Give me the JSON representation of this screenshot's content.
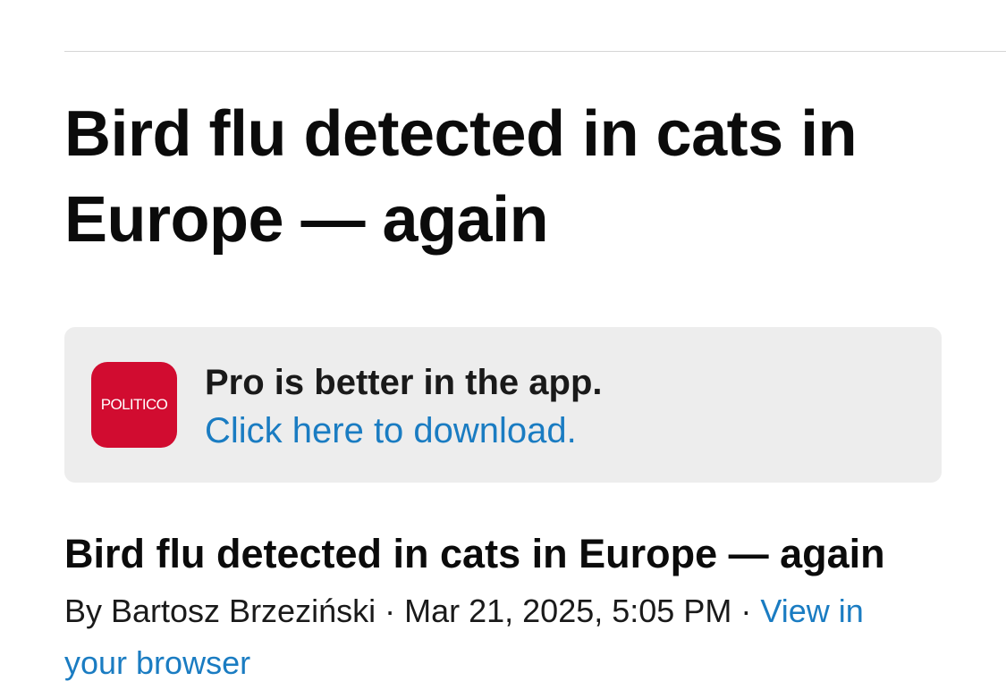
{
  "headline": "Bird flu detected in cats in Europe — again",
  "app_banner": {
    "icon_text": "POLITICO",
    "icon_color": "#d10c30",
    "title": "Pro is better in the app.",
    "link_text": "Click here to download."
  },
  "article": {
    "title": "Bird flu detected in cats in Europe — again",
    "author": "By Bartosz Brzeziński",
    "separator": " · ",
    "timestamp": "Mar 21, 2025, 5:05 PM",
    "browser_link": "View in your browser"
  },
  "colors": {
    "link": "#1a7cc2",
    "banner_bg": "#ededed"
  }
}
